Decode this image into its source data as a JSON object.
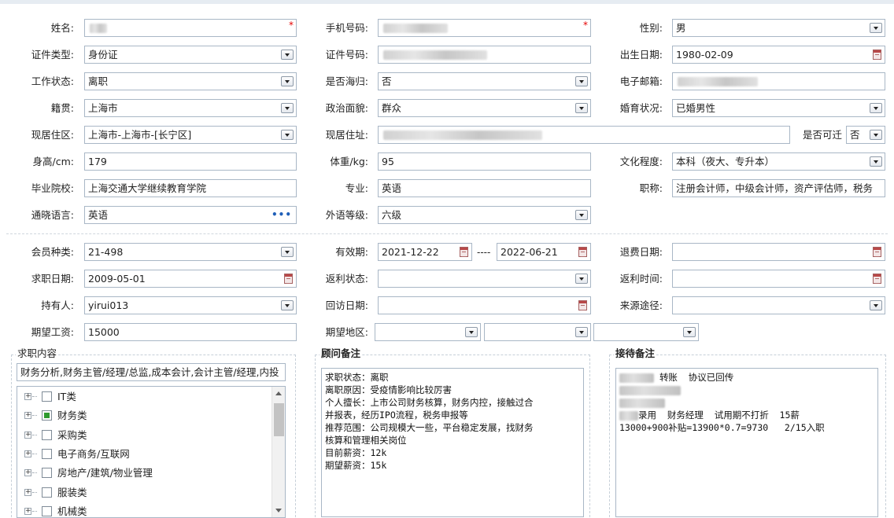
{
  "basic": {
    "name": {
      "label": "姓名:",
      "value": ""
    },
    "phone": {
      "label": "手机号码:",
      "value": ""
    },
    "gender": {
      "label": "性别:",
      "value": "男"
    },
    "id_type": {
      "label": "证件类型:",
      "value": "身份证"
    },
    "id_no": {
      "label": "证件号码:",
      "value": ""
    },
    "birth": {
      "label": "出生日期:",
      "value": "1980-02-09"
    },
    "work_status": {
      "label": "工作状态:",
      "value": "离职"
    },
    "returnee": {
      "label": "是否海归:",
      "value": "否"
    },
    "email": {
      "label": "电子邮箱:",
      "value": ""
    },
    "native": {
      "label": "籍贯:",
      "value": "上海市"
    },
    "political": {
      "label": "政治面貌:",
      "value": "群众"
    },
    "marital": {
      "label": "婚育状况:",
      "value": "已婚男性"
    },
    "region": {
      "label": "现居住区:",
      "value": "上海市-上海市-[长宁区]"
    },
    "address": {
      "label": "现居住址:",
      "value": ""
    },
    "relocate": {
      "label": "是否可迁",
      "value": "否"
    },
    "height": {
      "label": "身高/cm:",
      "value": "179"
    },
    "weight": {
      "label": "体重/kg:",
      "value": "95"
    },
    "education": {
      "label": "文化程度:",
      "value": "本科（夜大、专升本）"
    },
    "school": {
      "label": "毕业院校:",
      "value": "上海交通大学继续教育学院"
    },
    "major": {
      "label": "专业:",
      "value": "英语"
    },
    "title": {
      "label": "职称:",
      "value": "注册会计师，中级会计师，资产评估师，税务"
    },
    "language": {
      "label": "通晓语言:",
      "value": "英语",
      "more_icon": "ellipsis-icon"
    },
    "lang_level": {
      "label": "外语等级:",
      "value": "六级"
    }
  },
  "member": {
    "member_type": {
      "label": "会员种类:",
      "value": "21-498"
    },
    "valid": {
      "label": "有效期:",
      "start": "2021-12-22",
      "sep": "----",
      "end": "2022-06-21"
    },
    "refund_date": {
      "label": "退费日期:",
      "value": ""
    },
    "apply_date": {
      "label": "求职日期:",
      "value": "2009-05-01"
    },
    "rebate_status": {
      "label": "返利状态:",
      "value": ""
    },
    "rebate_time": {
      "label": "返利时间:",
      "value": ""
    },
    "holder": {
      "label": "持有人:",
      "value": "yirui013"
    },
    "visit_date": {
      "label": "回访日期:",
      "value": ""
    },
    "source": {
      "label": "来源途径:",
      "value": ""
    },
    "salary": {
      "label": "期望工资:",
      "value": "15000"
    },
    "area": {
      "label": "期望地区:",
      "v1": "",
      "v2": "",
      "v3": ""
    }
  },
  "job": {
    "title": "求职内容",
    "summary": "财务分析,财务主管/经理/总监,成本会计,会计主管/经理,内投",
    "tree": [
      {
        "label": "IT类",
        "checked": false
      },
      {
        "label": "财务类",
        "checked": true
      },
      {
        "label": "采购类",
        "checked": false
      },
      {
        "label": "电子商务/互联网",
        "checked": false
      },
      {
        "label": "房地产/建筑/物业管理",
        "checked": false
      },
      {
        "label": "服装类",
        "checked": false
      },
      {
        "label": "机械类",
        "checked": false
      }
    ]
  },
  "consultant": {
    "title": "顾问备注",
    "lines": [
      "求职状态：离职",
      "离职原因：受疫情影响比较厉害",
      "个人擅长：上市公司财务核算，财务内控，接触过合",
      "并报表，经历IPO流程，税务申报等",
      "推荐范围：公司规模大一些，平台稳定发展，找财务",
      "核算和管理相关岗位",
      "目前薪资：12k",
      "期望薪资：15k"
    ]
  },
  "reception": {
    "title": "接待备注",
    "line1": "转账  协议已回传",
    "line4": "录用  财务经理  试用期不打折  15薪",
    "line5": "13000+900补贴=13900*0.7=9730   2/15入职"
  },
  "colors": {
    "border": "#a9b7c6",
    "required": "#e60000",
    "checked": "#2f9a2f",
    "calendar": "#b94848"
  }
}
